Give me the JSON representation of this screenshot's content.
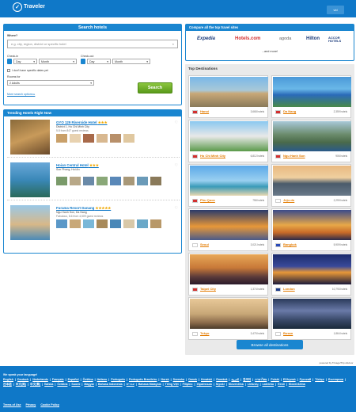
{
  "header": {
    "brand": "Traveler",
    "language_button": "vid"
  },
  "search": {
    "title": "Search hotels",
    "where_label": "Where?",
    "where_placeholder": "e.g. city, region, district or specific hotel",
    "clear": "×",
    "checkin_label": "Check-in",
    "checkout_label": "Check-out",
    "day": "Day",
    "month": "Month",
    "no_dates": "I don't have specific dates yet",
    "rooms_label": "Rooms for",
    "rooms_value": "2 Adults",
    "more_options": "More search options ▸",
    "search_button": "Search"
  },
  "trending": {
    "title": "Trending Hotels Right Now",
    "hotels": [
      {
        "name": "GYO 129 Riverside Hotel",
        "stars": "★★★",
        "address": "District 1, Ho Chi Minh City",
        "reviews": "5.8 from 847 guest reviews"
      },
      {
        "name": "Hoian Central Hotel",
        "stars": "★★★",
        "address": "Son Phong, Hoi An",
        "reviews": ""
      },
      {
        "name": "Furama Resort Danang",
        "stars": "★★★★★",
        "address": "Ngu Hanh Son, Da Nang",
        "reviews": "Fabulous, 8.6 from 4,509 guest reviews"
      }
    ]
  },
  "compare": {
    "title": "Compare all the top travel sites",
    "brands": [
      "Expedia",
      "Hotels.com",
      "agoda",
      "Hilton",
      "ACCOR HOTELS"
    ],
    "more": "...and more!"
  },
  "destinations": {
    "title": "Top Destinations",
    "items": [
      {
        "name": "Hanoi",
        "count": "3,668 hotels"
      },
      {
        "name": "Da Nang",
        "count": "2,359 hotels"
      },
      {
        "name": "Ho Chi Minh City",
        "count": "6,812 hotels"
      },
      {
        "name": "Ngu Hanh Son",
        "count": "906 hotels"
      },
      {
        "name": "Phu Quoc",
        "count": "758 hotels"
      },
      {
        "name": "Jeju-do",
        "count": "2,299 hotels"
      },
      {
        "name": "Seoul",
        "count": "3,021 hotels"
      },
      {
        "name": "Bangkok",
        "count": "5,909 hotels"
      },
      {
        "name": "Taipei City",
        "count": "1,374 hotels"
      },
      {
        "name": "London",
        "count": "10,793 hotels"
      },
      {
        "name": "Tokyo",
        "count": "3,475 hotels"
      },
      {
        "name": "Busan",
        "count": "1,864 hotels"
      }
    ],
    "browse_button": "Browse all destinations"
  },
  "powered_by": "powered by\nTrivago/Trip Advisor",
  "footer": {
    "language_title": "We speak your language!",
    "languages": [
      "English",
      "Deutsch",
      "Nederlands",
      "Français",
      "Español",
      "Čeština",
      "Italiano",
      "Português",
      "Português Brasileiro",
      "Norsk",
      "Svenska",
      "Dansk",
      "Hrvatski",
      "Română",
      "العربية",
      "한국어",
      "ภาษาไทย",
      "Polski",
      "Ελληνικά",
      "Русский",
      "Türkçe",
      "Български",
      "日本語",
      "中文(简)",
      "中文(繁)",
      "Ítalska",
      "Čeština",
      "Suomi",
      "Magyar",
      "Bahasa Indonesia",
      "עברית",
      "Bahasa Malaysia",
      "Tiếng Việt",
      "Filipino",
      "Українська",
      "Srpski",
      "Slovenčina",
      "Lietuvių",
      "Latviešu",
      "Eesti",
      "Slovenščina"
    ],
    "links": [
      "Terms of Use",
      "Privacy",
      "Cookie Policy"
    ]
  }
}
